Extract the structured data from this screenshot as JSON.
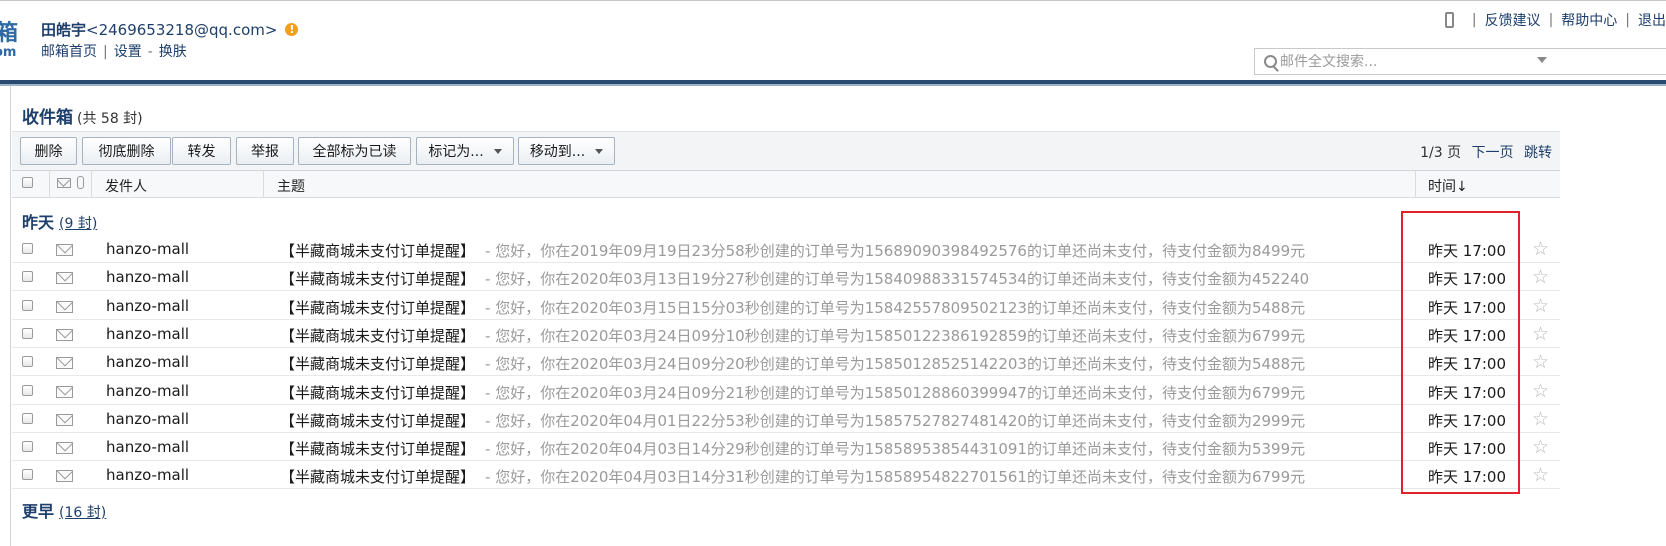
{
  "header": {
    "logo_char": "箱",
    "logo_sub": "om",
    "user_name": "田皓宇",
    "user_email": "<2469653218@qq.com>",
    "warn_glyph": "!",
    "links": [
      "邮箱首页",
      "设置",
      "换肤"
    ],
    "link_sep": "|",
    "link_dash": "-",
    "top_links": [
      "反馈建议",
      "帮助中心",
      "退出"
    ],
    "search_placeholder": "邮件全文搜索..."
  },
  "folder": {
    "name": "收件箱",
    "count_text": "(共 58 封)"
  },
  "toolbar": {
    "delete": "删除",
    "delete_permanent": "彻底删除",
    "forward": "转发",
    "report": "举报",
    "mark_all_read": "全部标为已读",
    "mark_as": "标记为...",
    "move_to": "移动到..."
  },
  "pager": {
    "page_text": "1/3 页",
    "next": "下一页",
    "jump": "跳转"
  },
  "columns": {
    "sender": "发件人",
    "subject": "主题",
    "time": "时间↓"
  },
  "groups": [
    {
      "name": "昨天",
      "count": "(9 封)"
    },
    {
      "name": "更早",
      "count": "(16 封)"
    }
  ],
  "messages": [
    {
      "sender": "hanzo-mall",
      "subject": "【半藏商城未支付订单提醒】",
      "preview": "- 您好，你在2019年09月19日23分58秒创建的订单号为15689090398492576的订单还尚未支付，待支付金额为8499元",
      "time": "昨天 17:00"
    },
    {
      "sender": "hanzo-mall",
      "subject": "【半藏商城未支付订单提醒】",
      "preview": "- 您好，你在2020年03月13日19分27秒创建的订单号为15840988331574534的订单还尚未支付，待支付金额为452240",
      "time": "昨天 17:00"
    },
    {
      "sender": "hanzo-mall",
      "subject": "【半藏商城未支付订单提醒】",
      "preview": "- 您好，你在2020年03月15日15分03秒创建的订单号为15842557809502123的订单还尚未支付，待支付金额为5488元",
      "time": "昨天 17:00"
    },
    {
      "sender": "hanzo-mall",
      "subject": "【半藏商城未支付订单提醒】",
      "preview": "- 您好，你在2020年03月24日09分10秒创建的订单号为15850122386192859的订单还尚未支付，待支付金额为6799元",
      "time": "昨天 17:00"
    },
    {
      "sender": "hanzo-mall",
      "subject": "【半藏商城未支付订单提醒】",
      "preview": "- 您好，你在2020年03月24日09分20秒创建的订单号为15850128525142203的订单还尚未支付，待支付金额为5488元",
      "time": "昨天 17:00"
    },
    {
      "sender": "hanzo-mall",
      "subject": "【半藏商城未支付订单提醒】",
      "preview": "- 您好，你在2020年03月24日09分21秒创建的订单号为15850128860399947的订单还尚未支付，待支付金额为6799元",
      "time": "昨天 17:00"
    },
    {
      "sender": "hanzo-mall",
      "subject": "【半藏商城未支付订单提醒】",
      "preview": "- 您好，你在2020年04月01日22分53秒创建的订单号为15857527827481420的订单还尚未支付，待支付金额为2999元",
      "time": "昨天 17:00"
    },
    {
      "sender": "hanzo-mall",
      "subject": "【半藏商城未支付订单提醒】",
      "preview": "- 您好，你在2020年04月03日14分29秒创建的订单号为15858953854431091的订单还尚未支付，待支付金额为5399元",
      "time": "昨天 17:00"
    },
    {
      "sender": "hanzo-mall",
      "subject": "【半藏商城未支付订单提醒】",
      "preview": "- 您好，你在2020年04月03日14分31秒创建的订单号为15858954822701561的订单还尚未支付，待支付金额为6799元",
      "time": "昨天 17:00"
    }
  ],
  "icons": {
    "star": "☆",
    "row_mail": "envelope-icon"
  },
  "colors": {
    "link": "#1e3f6b",
    "header_bar": "#2b4a6f",
    "highlight": "#e0222a",
    "preview_text": "#9a9a9a"
  }
}
